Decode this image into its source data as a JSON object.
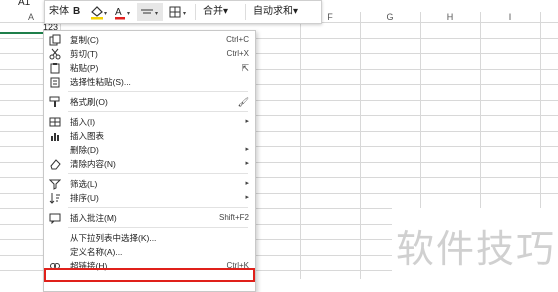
{
  "spreadsheet": {
    "name_box": "A1",
    "active_cell_value": "123",
    "active_col": "A",
    "columns": [
      "F",
      "G",
      "H",
      "I"
    ]
  },
  "mini_toolbar": {
    "font_name": "宋体",
    "bold": "B",
    "merge_label": "合并",
    "autosum_label": "自动求和",
    "dropdown_glyph": "▾"
  },
  "context_menu": {
    "items": [
      {
        "icon": "copy-icon",
        "label": "复制(C)",
        "shortcut": "Ctrl+C"
      },
      {
        "icon": "cut-icon",
        "label": "剪切(T)",
        "shortcut": "Ctrl+X"
      },
      {
        "icon": "paste-icon",
        "label": "粘贴(P)",
        "shortcut": ""
      },
      {
        "icon": "paste-special-icon",
        "label": "选择性粘贴(S)...",
        "shortcut": ""
      },
      {
        "icon": "format-painter-icon",
        "label": "格式刷(O)",
        "shortcut": ""
      },
      {
        "icon": "insert-icon",
        "label": "插入(I)",
        "shortcut": ""
      },
      {
        "icon": "chart-icon",
        "label": "插入图表",
        "shortcut": ""
      },
      {
        "icon": "",
        "label": "删除(D)",
        "shortcut": ""
      },
      {
        "icon": "clear-icon",
        "label": "清除内容(N)",
        "shortcut": ""
      },
      {
        "icon": "filter-icon",
        "label": "筛选(L)",
        "shortcut": ""
      },
      {
        "icon": "sort-icon",
        "label": "排序(U)",
        "shortcut": ""
      },
      {
        "icon": "comment-icon",
        "label": "插入批注(M)",
        "shortcut": "Shift+F2"
      },
      {
        "icon": "",
        "label": "从下拉列表中选择(K)...",
        "shortcut": ""
      },
      {
        "icon": "",
        "label": "定义名称(A)...",
        "shortcut": ""
      },
      {
        "icon": "hyperlink-icon",
        "label": "超链接(H)...",
        "shortcut": "Ctrl+K"
      }
    ]
  },
  "watermark": {
    "text": "软件技巧"
  },
  "colors": {
    "accent_green": "#1e7f4a",
    "highlight_red": "#e0201a"
  }
}
